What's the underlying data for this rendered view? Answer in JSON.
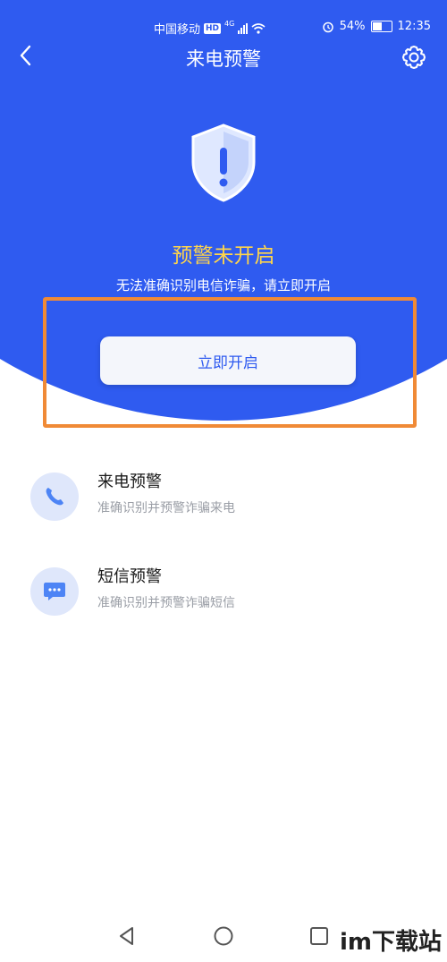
{
  "status_bar": {
    "carrier": "中国移动",
    "hd": "HD",
    "network": "4G",
    "battery": "54%",
    "battery_level": 0.54,
    "time": "12:35"
  },
  "header": {
    "title": "来电预警"
  },
  "hero": {
    "status_title": "预警未开启",
    "status_desc": "无法准确识别电信诈骗，请立即开启",
    "enable_label": "立即开启"
  },
  "features": [
    {
      "name": "来电预警",
      "desc": "准确识别并预警诈骗来电",
      "icon": "phone-icon"
    },
    {
      "name": "短信预警",
      "desc": "准确识别并预警诈骗短信",
      "icon": "message-icon"
    }
  ],
  "watermark": "im下载站",
  "colors": {
    "primary": "#2f5bf0",
    "warning_text": "#ffd54a",
    "highlight": "#f08a36"
  }
}
